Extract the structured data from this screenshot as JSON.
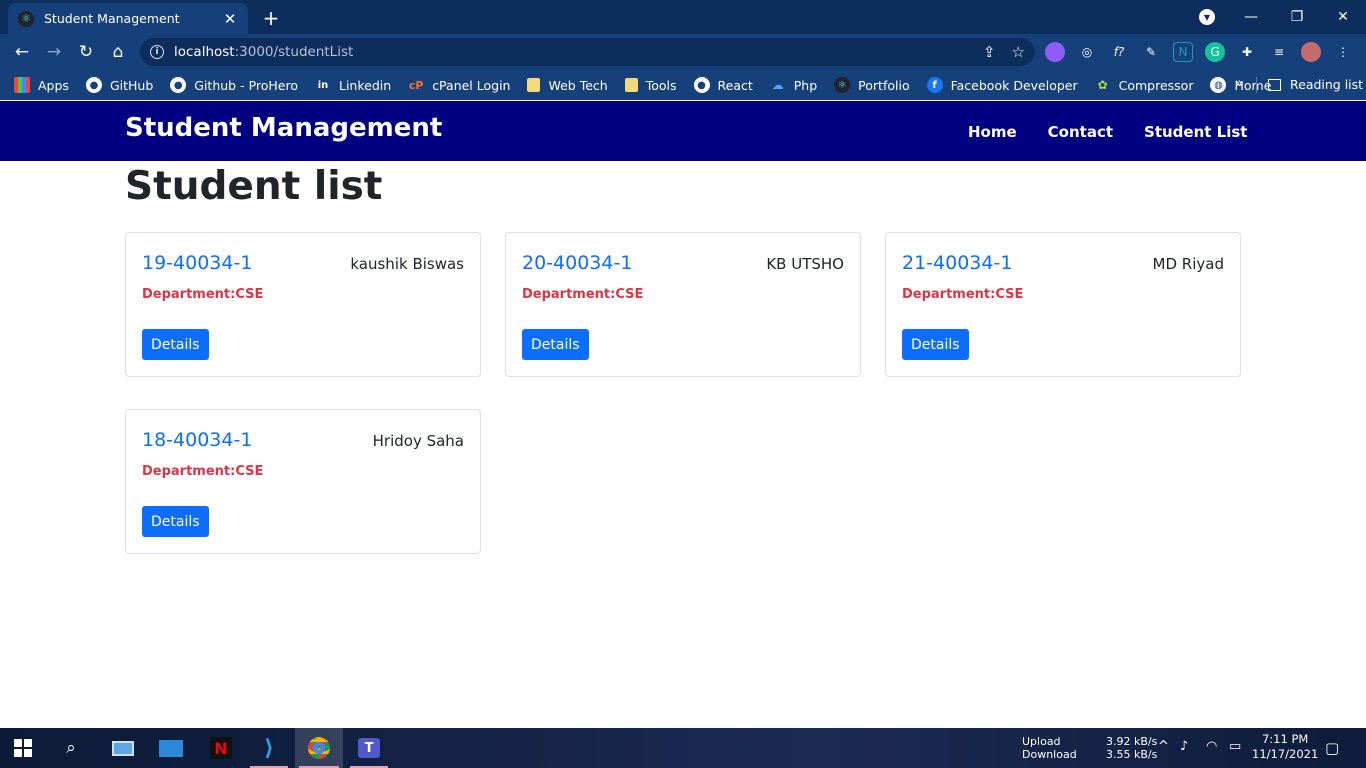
{
  "browser": {
    "tab_title": "Student Management",
    "url_host": "localhost",
    "url_path": ":3000/studentList",
    "bookmarks": [
      {
        "label": "Apps"
      },
      {
        "label": "GitHub"
      },
      {
        "label": "Github - ProHero"
      },
      {
        "label": "Linkedin"
      },
      {
        "label": "cPanel Login"
      },
      {
        "label": "Web Tech"
      },
      {
        "label": "Tools"
      },
      {
        "label": "React"
      },
      {
        "label": "Php"
      },
      {
        "label": "Portfolio"
      },
      {
        "label": "Facebook Developer"
      },
      {
        "label": "Compressor"
      },
      {
        "label": "Home"
      }
    ],
    "bookmarks_more": "»",
    "reading_list": "Reading list"
  },
  "app": {
    "brand": "Student Management",
    "nav": {
      "home": "Home",
      "contact": "Contact",
      "student_list": "Student List"
    },
    "page_title": "Student list",
    "students": [
      {
        "id": "19-40034-1",
        "name": "kaushik Biswas",
        "department": "Department:CSE",
        "button": "Details"
      },
      {
        "id": "20-40034-1",
        "name": "KB UTSHO",
        "department": "Department:CSE",
        "button": "Details"
      },
      {
        "id": "21-40034-1",
        "name": "MD Riyad",
        "department": "Department:CSE",
        "button": "Details"
      },
      {
        "id": "18-40034-1",
        "name": "Hridoy Saha",
        "department": "Department:CSE",
        "button": "Details"
      }
    ]
  },
  "taskbar": {
    "upload_label": "Upload",
    "download_label": "Download",
    "upload_speed": "3.92 kB/s",
    "download_speed": "3.55 kB/s",
    "time": "7:11 PM",
    "date": "11/17/2021"
  },
  "colors": {
    "navbar": "#000080",
    "link_blue": "#0d6efd",
    "department_red": "#dc3545",
    "chrome_dark": "#0d2d5c",
    "chrome_light": "#16407a"
  }
}
